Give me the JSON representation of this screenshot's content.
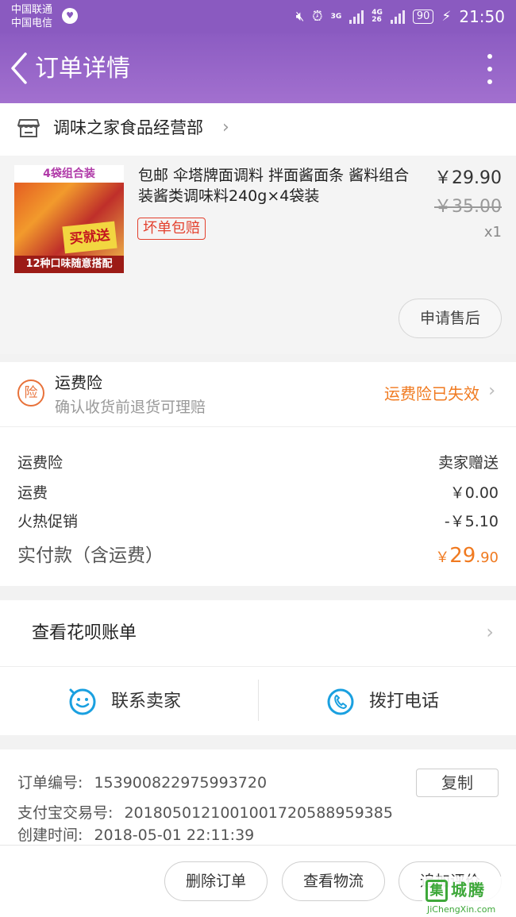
{
  "status_bar": {
    "carrier_1": "中国联通",
    "carrier_2": "中国电信",
    "network_top": "3G",
    "network_4g": "4G",
    "network_26": "26",
    "battery": "90",
    "time": "21:50"
  },
  "header": {
    "title": "订单详情"
  },
  "shop": {
    "name": "调味之家食品经营部"
  },
  "product": {
    "title": "包邮 伞塔牌面调料 拌面酱面条 酱料组合装酱类调味料240g×4袋装",
    "guarantee_tag": "坏单包赔",
    "price": "￥29.90",
    "original_price": "￥35.00",
    "quantity": "x1",
    "aftersale_button": "申请售后",
    "image_text_top": "4袋组合装",
    "image_text_badge": "买就送",
    "image_text_bottom": "12种口味随意搭配"
  },
  "insurance": {
    "title": "运费险",
    "subtitle": "确认收货前退货可理赔",
    "status": "运费险已失效",
    "icon_char": "险"
  },
  "costs": {
    "rows": [
      {
        "label": "运费险",
        "value": "卖家赠送"
      },
      {
        "label": "运费",
        "value": "￥0.00"
      },
      {
        "label": "火热促销",
        "value": "-￥5.10"
      }
    ],
    "total_label": "实付款（含运费）",
    "total_currency": "￥",
    "total_int": "29",
    "total_dec": ".90"
  },
  "huabei": {
    "label": "查看花呗账单"
  },
  "contact": {
    "seller": "联系卖家",
    "phone": "拨打电话"
  },
  "order": {
    "number_label": "订单编号:",
    "number": "153900822975993720",
    "alipay_label": "支付宝交易号:",
    "alipay_no": "2018050121001001720588959385",
    "created_label": "创建时间:",
    "created_at": "2018-05-01 22:11:39",
    "copy_button": "复制"
  },
  "bottom_actions": {
    "delete": "删除订单",
    "logistics": "查看物流",
    "review": "追加评价"
  },
  "watermark": {
    "mark": "集",
    "name": "城腾",
    "url": "JiChengXin.com"
  },
  "colors": {
    "header": "#8c5cc2",
    "accent_orange": "#f07a20",
    "tag_red": "#e3402d",
    "icon_blue": "#1aa0e0"
  }
}
